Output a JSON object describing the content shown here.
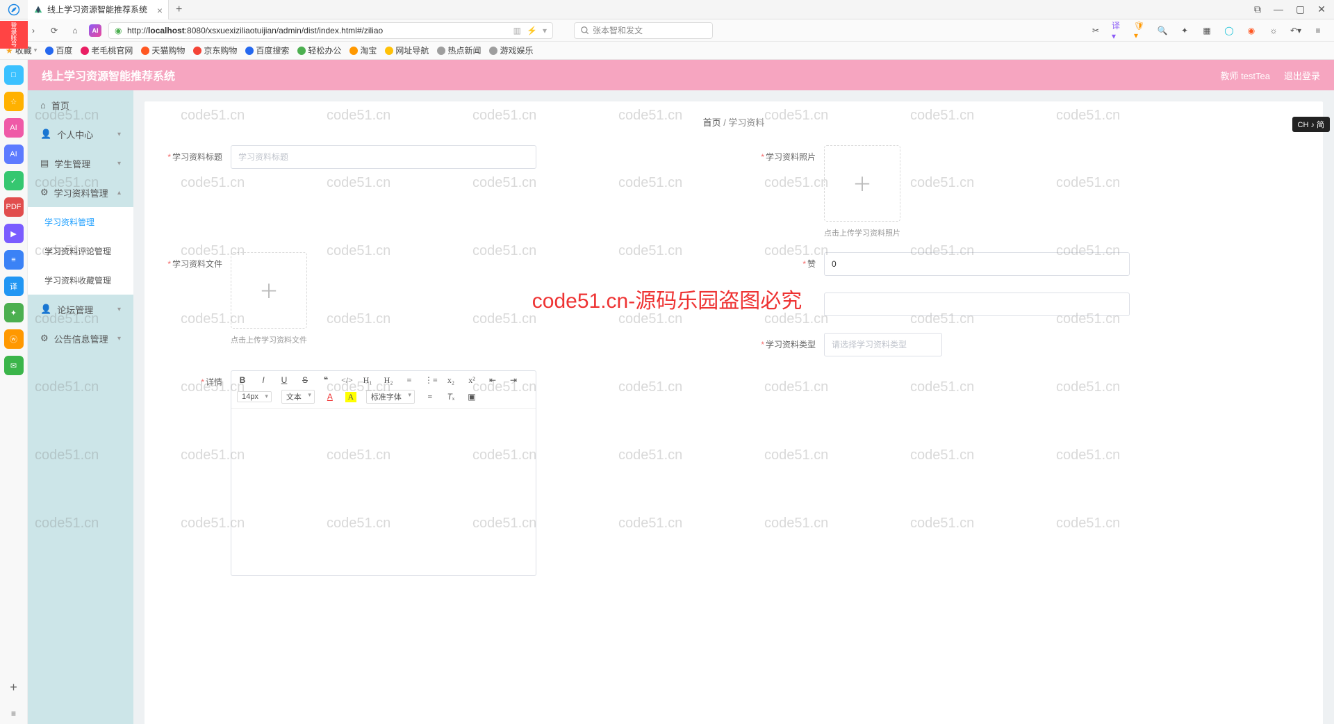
{
  "browser": {
    "tab_title": "线上学习资源智能推荐系统",
    "tab_add": "+",
    "url_prefix": "http://",
    "url_host": "localhost",
    "url_path": ":8080/xsxuexiziliaotuijian/admin/dist/index.html#/ziliao",
    "search_placeholder": "张本智和发文",
    "win_controls": [
      "⬜",
      "—",
      "▢",
      "✕"
    ]
  },
  "bookmarks": {
    "fav_label": "收藏",
    "items": [
      "百度",
      "老毛桃官网",
      "天猫购物",
      "京东购物",
      "百度搜索",
      "轻松办公",
      "淘宝",
      "网址导航",
      "热点新闻",
      "游戏娱乐"
    ]
  },
  "os_apps": [
    {
      "bg": "#3bc1ff",
      "t": "□"
    },
    {
      "bg": "#ffb100",
      "t": "☆"
    },
    {
      "bg": "#ef5aa7",
      "t": "AI"
    },
    {
      "bg": "#5d7bff",
      "t": "AI"
    },
    {
      "bg": "#35c770",
      "t": "✓"
    },
    {
      "bg": "#e14d4d",
      "t": "PDF"
    },
    {
      "bg": "#7a5cff",
      "t": "▶"
    },
    {
      "bg": "#3b82f6",
      "t": "≡"
    },
    {
      "bg": "#2196f3",
      "t": "译"
    },
    {
      "bg": "#4caf50",
      "t": "✦"
    },
    {
      "bg": "#ff9800",
      "t": "ⓦ"
    },
    {
      "bg": "#3bb54a",
      "t": "✉"
    }
  ],
  "login_tag": "登录账号",
  "app": {
    "title": "线上学习资源智能推荐系统",
    "user_label": "教师 testTea",
    "logout": "退出登录"
  },
  "menu": {
    "home": "首页",
    "personal": "个人中心",
    "student": "学生管理",
    "material": "学习资料管理",
    "material_sub": [
      "学习资料管理",
      "学习资料评论管理",
      "学习资料收藏管理"
    ],
    "forum": "论坛管理",
    "notice": "公告信息管理"
  },
  "breadcrumb": {
    "home": "首页",
    "sep": " / ",
    "current": "学习资料"
  },
  "form": {
    "title_label": "学习资料标题",
    "title_placeholder": "学习资料标题",
    "photo_label": "学习资料照片",
    "photo_hint": "点击上传学习资料照片",
    "file_label": "学习资料文件",
    "file_hint": "点击上传学习资料文件",
    "like_label": "赞",
    "like_value": "0",
    "type_label": "学习资料类型",
    "type_placeholder": "请选择学习资料类型",
    "detail_label": "详情",
    "editor": {
      "fontsize": "14px",
      "para": "文本",
      "fontfamily": "标准字体"
    }
  },
  "watermark": "code51.cn",
  "big_watermark": "code51.cn-源码乐园盗图必究",
  "ime": "CH ♪ 简"
}
